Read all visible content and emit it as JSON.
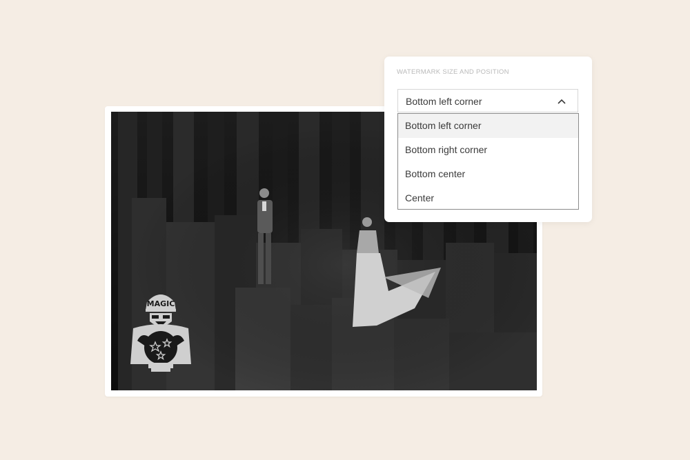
{
  "panel": {
    "title": "WATERMARK SIZE AND POSITION",
    "selected_value": "Bottom left corner",
    "options": [
      {
        "label": "Bottom left corner",
        "selected": true
      },
      {
        "label": "Bottom right corner",
        "selected": false
      },
      {
        "label": "Bottom center",
        "selected": false
      },
      {
        "label": "Center",
        "selected": false
      }
    ]
  },
  "watermark": {
    "cap_text": "MAGIC",
    "icon": "fortune-teller-icon"
  },
  "colors": {
    "background": "#f5ede4",
    "card": "#ffffff",
    "photo_dark": "#141414",
    "watermark": "#cfcfcf",
    "option_highlight": "#f2f2f2",
    "dropdown_border": "#8a8a8a"
  }
}
